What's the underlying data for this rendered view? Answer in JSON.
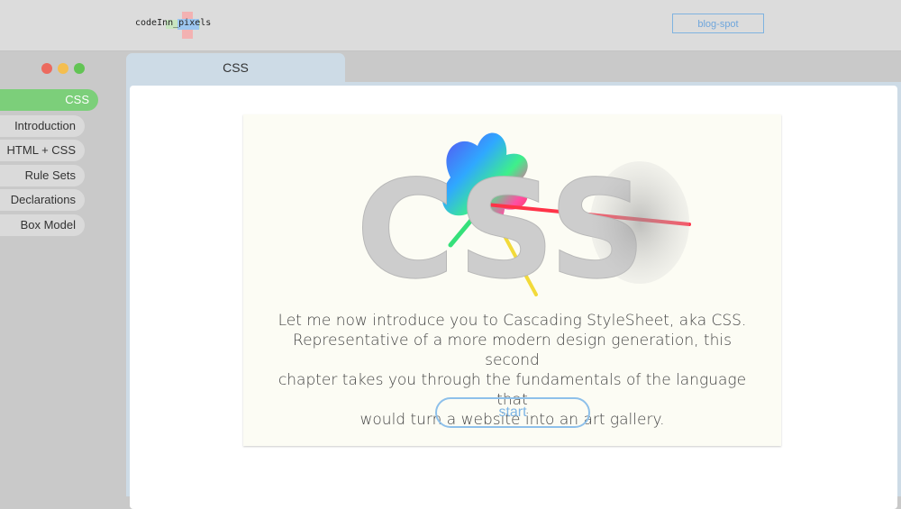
{
  "header": {
    "logo_text": "codeInn_pixels",
    "blog_button": "blog-spot"
  },
  "window": {
    "controls": [
      "close",
      "minimize",
      "maximize"
    ]
  },
  "sidebar": {
    "items": [
      {
        "label": "CSS",
        "active": true
      },
      {
        "label": "Introduction",
        "active": false
      },
      {
        "label": "HTML + CSS",
        "active": false
      },
      {
        "label": "Rule Sets",
        "active": false
      },
      {
        "label": "Declarations",
        "active": false
      },
      {
        "label": "Box Model",
        "active": false
      }
    ]
  },
  "tab": {
    "label": "CSS"
  },
  "main": {
    "hero_letters": "CSS",
    "intro_lines": [
      "Let me now introduce you to Cascading StyleSheet, aka CSS.",
      "Representative of a more modern design generation, this second",
      "chapter takes you through the fundamentals of the language that",
      "would turn a website into an art gallery."
    ],
    "start_button": "start"
  },
  "colors": {
    "active_green": "#7ccf7a",
    "accent_blue": "#7db5e6",
    "tab_blue": "#cddbe6"
  }
}
